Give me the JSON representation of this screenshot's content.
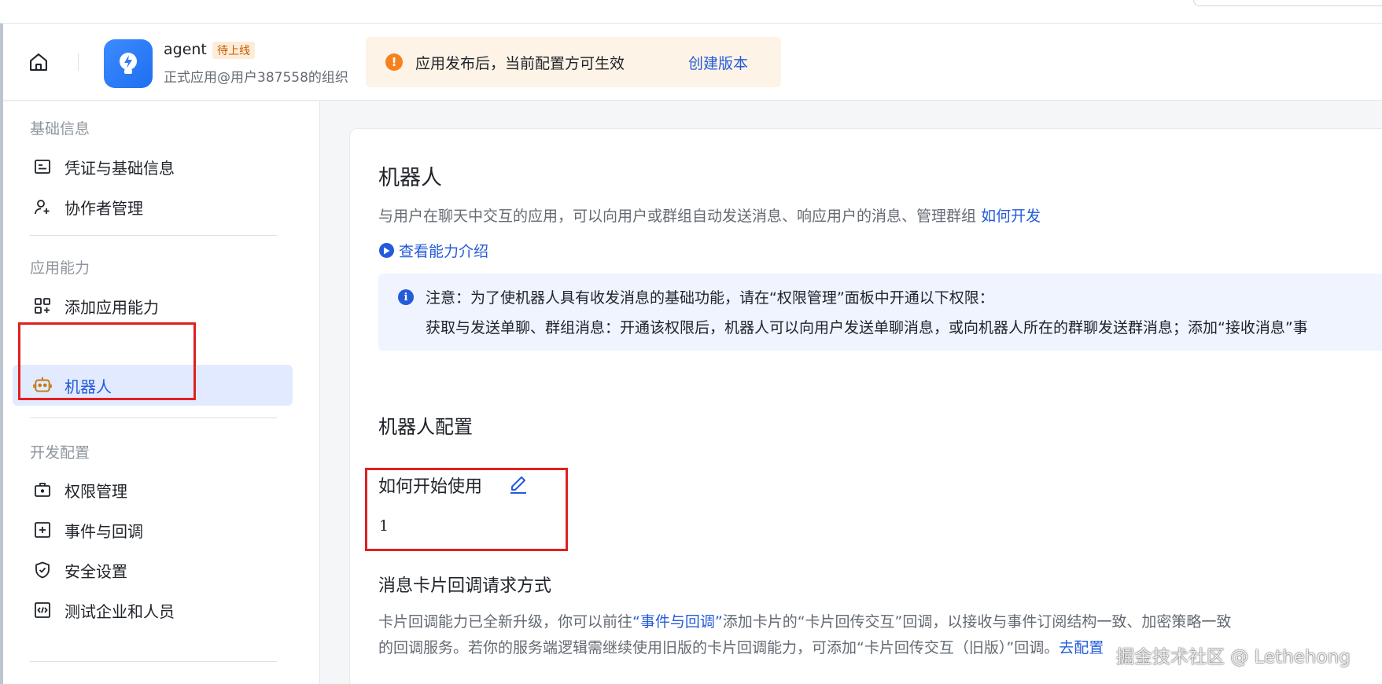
{
  "header": {
    "app_name": "agent",
    "app_status": "待上线",
    "app_org": "正式应用@用户387558的组织",
    "notice_text": "应用发布后，当前配置方可生效",
    "notice_link": "创建版本"
  },
  "sidebar": {
    "sections": [
      {
        "title": "基础信息",
        "items": [
          {
            "label": "凭证与基础信息",
            "icon": "id-card-icon"
          },
          {
            "label": "协作者管理",
            "icon": "add-user-icon"
          }
        ]
      },
      {
        "title": "应用能力",
        "items": [
          {
            "label": "添加应用能力",
            "icon": "add-apps-icon"
          },
          {
            "label": "机器人",
            "icon": "robot-icon",
            "active": true
          }
        ]
      },
      {
        "title": "开发配置",
        "items": [
          {
            "label": "权限管理",
            "icon": "briefcase-lock-icon"
          },
          {
            "label": "事件与回调",
            "icon": "plus-square-icon"
          },
          {
            "label": "安全设置",
            "icon": "shield-check-icon"
          },
          {
            "label": "测试企业和人员",
            "icon": "code-box-icon"
          }
        ]
      }
    ]
  },
  "main": {
    "title": "机器人",
    "description": "与用户在聊天中交互的应用，可以向用户或群组自动发送消息、响应用户的消息、管理群组",
    "description_link": "如何开发",
    "video_link": "查看能力介绍",
    "info": {
      "line1": "注意：为了使机器人具有收发消息的基础功能，请在“权限管理”面板中开通以下权限：",
      "line2": "获取与发送单聊、群组消息：开通该权限后，机器人可以向用户发送单聊消息，或向机器人所在的群聊发送群消息；添加“接收消息”事"
    },
    "config_title": "机器人配置",
    "getting_started_label": "如何开始使用",
    "getting_started_value": "1",
    "card_callback_title": "消息卡片回调请求方式",
    "card_callback_desc1_a": "卡片回调能力已全新升级，你可以前往",
    "card_callback_desc1_link": "“事件与回调”",
    "card_callback_desc1_b": "添加卡片的“卡片回传交互”回调，以接收与事件订阅结构一致、加密策略一致",
    "card_callback_desc2_a": "的回调服务。若你的服务端逻辑需继续使用旧版的卡片回调能力，可添加“卡片回传交互（旧版）”回调。",
    "card_callback_desc2_link": "去配置"
  },
  "watermark": "掘金技术社区 @ Lethehong",
  "colors": {
    "accent": "#245bdb",
    "active_bg": "#e1eaff",
    "highlight_box": "#e02020",
    "notice_bg": "#fdf3e6",
    "notice_icon": "#f5821f",
    "info_bg": "#eff4ff"
  }
}
